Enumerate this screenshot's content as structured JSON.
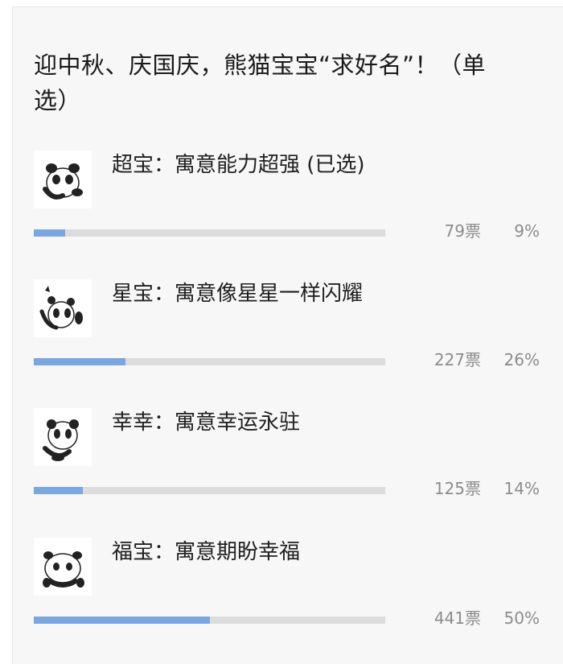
{
  "poll": {
    "title": "迎中秋、庆国庆，熊猫宝宝“求好名”！（单选）",
    "options": [
      {
        "label": "超宝：寓意能力超强 (已选)",
        "votes": "79票",
        "percent": "9%",
        "fraction": 0.09,
        "thumb_icon": "panda-sticker-icon"
      },
      {
        "label": "星宝：寓意像星星一样闪耀",
        "votes": "227票",
        "percent": "26%",
        "fraction": 0.26,
        "thumb_icon": "panda-sticker-icon"
      },
      {
        "label": "幸幸：寓意幸运永驻",
        "votes": "125票",
        "percent": "14%",
        "fraction": 0.14,
        "thumb_icon": "panda-sticker-icon"
      },
      {
        "label": "福宝：寓意期盼幸福",
        "votes": "441票",
        "percent": "50%",
        "fraction": 0.5,
        "thumb_icon": "panda-sticker-icon"
      }
    ]
  },
  "colors": {
    "bar_fill": "#7aa7e0",
    "bar_track": "#dcdcdc",
    "card_bg": "#f7f7f7",
    "muted_text": "#8c8c8c"
  }
}
